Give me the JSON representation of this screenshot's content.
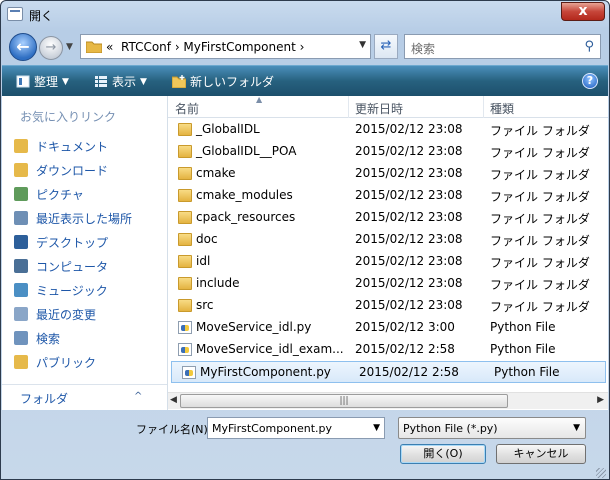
{
  "window": {
    "title": "開く",
    "close_label": "x"
  },
  "address": {
    "chevron": "«",
    "crumbs": "RTCConf  ›  MyFirstComponent  ›",
    "search_placeholder": "検索"
  },
  "toolbar": {
    "organize": "整理",
    "view": "表示",
    "new_folder": "新しいフォルダ",
    "help": "?"
  },
  "sidebar": {
    "favorites_header": "お気に入りリンク",
    "items": [
      {
        "label": "ドキュメント",
        "icon": "documents-icon",
        "color": "#e6b94a"
      },
      {
        "label": "ダウンロード",
        "icon": "downloads-icon",
        "color": "#e6b94a"
      },
      {
        "label": "ピクチャ",
        "icon": "pictures-icon",
        "color": "#5f9b5b"
      },
      {
        "label": "最近表示した場所",
        "icon": "recent-places-icon",
        "color": "#6e8fb5"
      },
      {
        "label": "デスクトップ",
        "icon": "desktop-icon",
        "color": "#2d5f9a"
      },
      {
        "label": "コンピュータ",
        "icon": "computer-icon",
        "color": "#4a6f96"
      },
      {
        "label": "ミュージック",
        "icon": "music-icon",
        "color": "#4b8fc4"
      },
      {
        "label": "最近の変更",
        "icon": "recent-changes-icon",
        "color": "#8aa6c8"
      },
      {
        "label": "検索",
        "icon": "search-folder-icon",
        "color": "#6f93bd"
      },
      {
        "label": "パブリック",
        "icon": "public-icon",
        "color": "#e6b94a"
      }
    ],
    "folders_label": "フォルダ",
    "folders_chevron": "^"
  },
  "columns": {
    "name": "名前",
    "date": "更新日時",
    "type": "種類"
  },
  "files": [
    {
      "name": "_GlobalIDL",
      "date": "2015/02/12 23:08",
      "type": "ファイル フォルダ",
      "kind": "folder"
    },
    {
      "name": "_GlobalIDL__POA",
      "date": "2015/02/12 23:08",
      "type": "ファイル フォルダ",
      "kind": "folder"
    },
    {
      "name": "cmake",
      "date": "2015/02/12 23:08",
      "type": "ファイル フォルダ",
      "kind": "folder"
    },
    {
      "name": "cmake_modules",
      "date": "2015/02/12 23:08",
      "type": "ファイル フォルダ",
      "kind": "folder"
    },
    {
      "name": "cpack_resources",
      "date": "2015/02/12 23:08",
      "type": "ファイル フォルダ",
      "kind": "folder"
    },
    {
      "name": "doc",
      "date": "2015/02/12 23:08",
      "type": "ファイル フォルダ",
      "kind": "folder"
    },
    {
      "name": "idl",
      "date": "2015/02/12 23:08",
      "type": "ファイル フォルダ",
      "kind": "folder"
    },
    {
      "name": "include",
      "date": "2015/02/12 23:08",
      "type": "ファイル フォルダ",
      "kind": "folder"
    },
    {
      "name": "src",
      "date": "2015/02/12 23:08",
      "type": "ファイル フォルダ",
      "kind": "folder"
    },
    {
      "name": "MoveService_idl.py",
      "date": "2015/02/12 3:00",
      "type": "Python File",
      "kind": "py"
    },
    {
      "name": "MoveService_idl_exam...",
      "date": "2015/02/12 2:58",
      "type": "Python File",
      "kind": "py"
    },
    {
      "name": "MyFirstComponent.py",
      "date": "2015/02/12 2:58",
      "type": "Python File",
      "kind": "py",
      "selected": true
    }
  ],
  "footer": {
    "filename_label": "ファイル名(N):",
    "filename_value": "MyFirstComponent.py",
    "filetype_value": "Python File (*.py)",
    "open_label": "開く(O)",
    "cancel_label": "キャンセル"
  }
}
